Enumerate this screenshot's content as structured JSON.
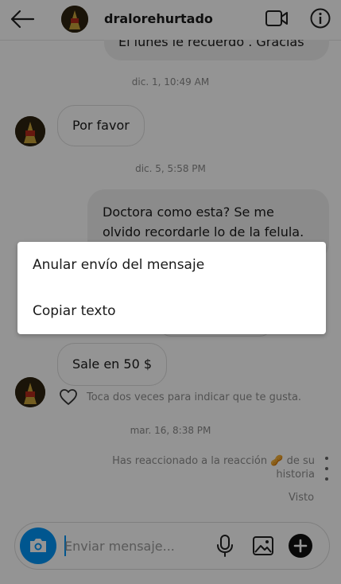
{
  "header": {
    "username": "dralorehurtado",
    "back_icon": "arrow-left-icon",
    "video_icon": "video-camera-icon",
    "info_icon": "info-icon"
  },
  "messages": {
    "top_partial": "El lunes le recuerdo . Gracias",
    "ts1": "dic. 1, 10:49 AM",
    "m_por_favor": "Por favor",
    "ts2": "dic. 5, 5:58 PM",
    "m_doctora_line1": "Doctora como esta? Se me",
    "m_doctora_line2": "olvido recordarle lo de la felula.",
    "m_sale": "Sale en 50 $",
    "like_hint": "Toca dos veces para indicar que te gusta.",
    "ts3": "mar. 16, 8:38 PM",
    "reacted_line1": "Has reaccionado a la reacción",
    "reacted_emoji": "🥜",
    "reacted_de_su": "de su",
    "reacted_line2": "historia",
    "seen": "Visto"
  },
  "composer": {
    "placeholder": "Enviar mensaje..."
  },
  "context_menu": {
    "item1": "Anular envío del mensaje",
    "item2": "Copiar texto"
  },
  "colors": {
    "accent": "#0095f6",
    "overlay": "rgba(0,0,0,0.42)"
  }
}
